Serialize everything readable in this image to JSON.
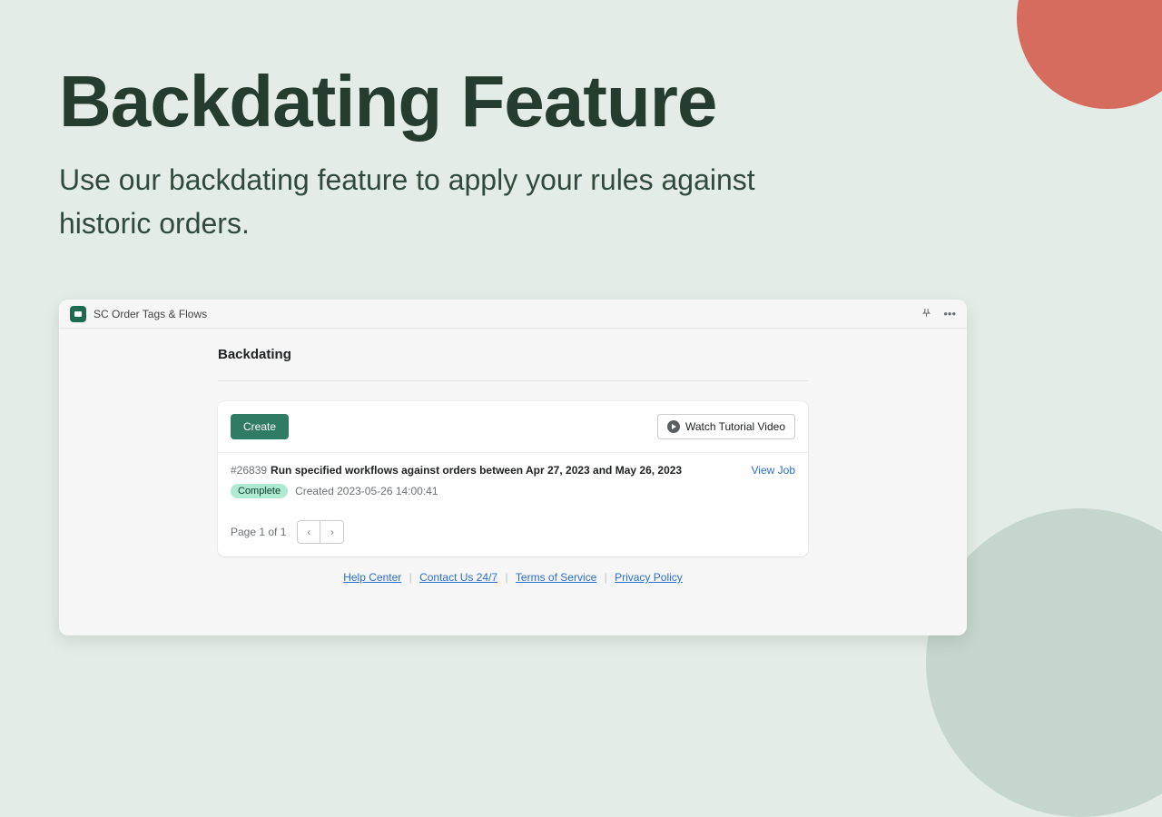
{
  "hero": {
    "title": "Backdating Feature",
    "subtitle": "Use our backdating feature to apply your rules against historic orders."
  },
  "app": {
    "title": "SC Order Tags & Flows",
    "section_title": "Backdating",
    "create_button": "Create",
    "tutorial_button": "Watch Tutorial Video",
    "job": {
      "id": "#26839",
      "description": "Run specified workflows against orders between Apr 27, 2023 and May 26, 2023",
      "view_label": "View Job",
      "status": "Complete",
      "created": "Created 2023-05-26 14:00:41"
    },
    "pagination": {
      "text": "Page 1 of 1",
      "prev": "‹",
      "next": "›"
    },
    "footer": {
      "help": "Help Center",
      "contact": "Contact Us 24/7",
      "terms": "Terms of Service",
      "privacy": "Privacy Policy"
    }
  }
}
